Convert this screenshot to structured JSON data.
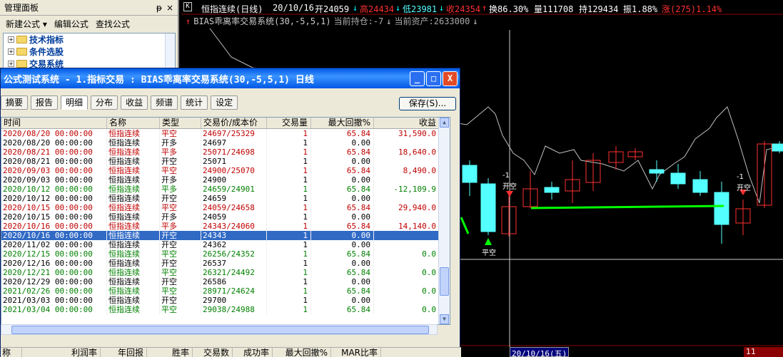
{
  "mgmt_panel": {
    "title": "管理面板",
    "pin": "ᵽ",
    "close": "×",
    "menu": [
      "新建公式 ▾",
      "编辑公式",
      "查找公式"
    ],
    "tree": [
      "技术指标",
      "条件选股",
      "交易系统"
    ]
  },
  "quote": {
    "flag": "K",
    "name": "恒指连续(日线)",
    "date": "20/10/16",
    "open": "开24059",
    "high": "高24434",
    "low": "低23981",
    "close": "收24354",
    "turnover": "换86.30%",
    "volume": "量111708",
    "hold": "持129434",
    "amplitude": "振1.88%",
    "change": "涨(275)1.14%"
  },
  "indicator": {
    "name": "BIAS乖离率交易系统(30,-5,5,1)",
    "position": "当前持仓:-7",
    "assets": "当前资产:2633000"
  },
  "signals": [
    {
      "num": "-1",
      "label": "开空"
    },
    {
      "num": "-1",
      "label": "开空"
    },
    {
      "num": "",
      "label": "平空"
    }
  ],
  "crosshair_date": "20/10/16(五)",
  "right_corner": "11",
  "dialog": {
    "title": "公式测试系统 - 1.指标交易 : BIAS乖离率交易系统(30,-5,5,1) 日线",
    "min": "_",
    "max": "□",
    "close": "X",
    "tabs": [
      "摘要",
      "报告",
      "明细",
      "分布",
      "收益",
      "频谱",
      "统计",
      "设定"
    ],
    "active_tab": "明细",
    "save_label": "保存(S)...",
    "columns": [
      "时间",
      "名称",
      "类型",
      "交易价/成本价",
      "交易量",
      "最大回撤%",
      "收益"
    ],
    "rows": [
      {
        "time": "2020/08/20 00:00:00",
        "name": "恒指连续",
        "type": "平空",
        "price": "24697/25329",
        "qty": "1",
        "dd": "65.84",
        "profit": "31,590.0",
        "color": "red"
      },
      {
        "time": "2020/08/20 00:00:00",
        "name": "恒指连续",
        "type": "开多",
        "price": "24697",
        "qty": "1",
        "dd": "0.00",
        "profit": "",
        "color": "black"
      },
      {
        "time": "2020/08/21 00:00:00",
        "name": "恒指连续",
        "type": "平多",
        "price": "25071/24698",
        "qty": "1",
        "dd": "65.84",
        "profit": "18,640.0",
        "color": "red"
      },
      {
        "time": "2020/08/21 00:00:00",
        "name": "恒指连续",
        "type": "开空",
        "price": "25071",
        "qty": "1",
        "dd": "0.00",
        "profit": "",
        "color": "black"
      },
      {
        "time": "2020/09/03 00:00:00",
        "name": "恒指连续",
        "type": "平空",
        "price": "24900/25070",
        "qty": "1",
        "dd": "65.84",
        "profit": "8,490.0",
        "color": "red"
      },
      {
        "time": "2020/09/03 00:00:00",
        "name": "恒指连续",
        "type": "开多",
        "price": "24900",
        "qty": "1",
        "dd": "0.00",
        "profit": "",
        "color": "black"
      },
      {
        "time": "2020/10/12 00:00:00",
        "name": "恒指连续",
        "type": "平多",
        "price": "24659/24901",
        "qty": "1",
        "dd": "65.84",
        "profit": "-12,109.9",
        "color": "green"
      },
      {
        "time": "2020/10/12 00:00:00",
        "name": "恒指连续",
        "type": "开空",
        "price": "24659",
        "qty": "1",
        "dd": "0.00",
        "profit": "",
        "color": "black"
      },
      {
        "time": "2020/10/15 00:00:00",
        "name": "恒指连续",
        "type": "平空",
        "price": "24059/24658",
        "qty": "1",
        "dd": "65.84",
        "profit": "29,940.0",
        "color": "red"
      },
      {
        "time": "2020/10/15 00:00:00",
        "name": "恒指连续",
        "type": "开多",
        "price": "24059",
        "qty": "1",
        "dd": "0.00",
        "profit": "",
        "color": "black"
      },
      {
        "time": "2020/10/16 00:00:00",
        "name": "恒指连续",
        "type": "平多",
        "price": "24343/24060",
        "qty": "1",
        "dd": "65.84",
        "profit": "14,140.0",
        "color": "red"
      },
      {
        "time": "2020/10/16 00:00:00",
        "name": "恒指连续",
        "type": "开空",
        "price": "24343",
        "qty": "1",
        "dd": "0.00",
        "profit": "",
        "color": "black",
        "selected": true
      },
      {
        "time": "2020/11/02 00:00:00",
        "name": "恒指连续",
        "type": "开空",
        "price": "24362",
        "qty": "1",
        "dd": "0.00",
        "profit": "",
        "color": "black"
      },
      {
        "time": "2020/12/15 00:00:00",
        "name": "恒指连续",
        "type": "平空",
        "price": "26256/24352",
        "qty": "1",
        "dd": "65.84",
        "profit": "0.0",
        "color": "green"
      },
      {
        "time": "2020/12/16 00:00:00",
        "name": "恒指连续",
        "type": "开空",
        "price": "26537",
        "qty": "1",
        "dd": "0.00",
        "profit": "",
        "color": "black"
      },
      {
        "time": "2020/12/21 00:00:00",
        "name": "恒指连续",
        "type": "平空",
        "price": "26321/24492",
        "qty": "1",
        "dd": "65.84",
        "profit": "0.0",
        "color": "green"
      },
      {
        "time": "2020/12/29 00:00:00",
        "name": "恒指连续",
        "type": "开空",
        "price": "26586",
        "qty": "1",
        "dd": "0.00",
        "profit": "",
        "color": "black"
      },
      {
        "time": "2021/02/26 00:00:00",
        "name": "恒指连续",
        "type": "平空",
        "price": "28971/24624",
        "qty": "1",
        "dd": "65.84",
        "profit": "0.0",
        "color": "green"
      },
      {
        "time": "2021/03/03 00:00:00",
        "name": "恒指连续",
        "type": "开空",
        "price": "29700",
        "qty": "1",
        "dd": "0.00",
        "profit": "",
        "color": "black"
      },
      {
        "time": "2021/03/04 00:00:00",
        "name": "恒指连续",
        "type": "平空",
        "price": "29038/24988",
        "qty": "1",
        "dd": "65.84",
        "profit": "0.0",
        "color": "green"
      }
    ],
    "summary_columns": [
      "称",
      "利润率",
      "年回报",
      "胜率",
      "交易数",
      "成功率",
      "最大回撤%",
      "MAR比率"
    ]
  },
  "colors": {
    "up_red": "#ff3030",
    "down_cyan": "#54ffff",
    "signal_green": "#00ff00",
    "row_red": "#c00000",
    "row_green": "#008000",
    "selection": "#316ac5"
  }
}
